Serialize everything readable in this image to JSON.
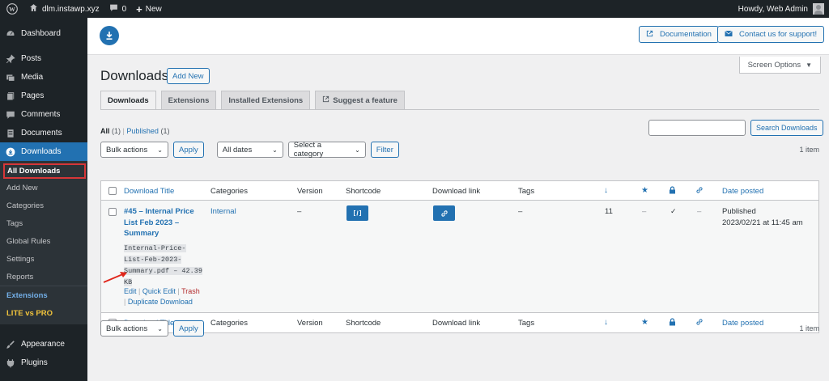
{
  "adminbar": {
    "site_name": "dlm.instawp.xyz",
    "comments_count": "0",
    "new_label": "New",
    "greeting": "Howdy, Web Admin"
  },
  "sidebar": {
    "items": [
      {
        "label": "Dashboard",
        "icon": "dashboard-icon"
      },
      {
        "label": "Posts",
        "icon": "pin-icon"
      },
      {
        "label": "Media",
        "icon": "media-icon"
      },
      {
        "label": "Pages",
        "icon": "pages-icon"
      },
      {
        "label": "Comments",
        "icon": "comment-icon"
      },
      {
        "label": "Documents",
        "icon": "document-icon"
      },
      {
        "label": "Downloads",
        "icon": "download-icon"
      }
    ],
    "submenu": [
      "All Downloads",
      "Add New",
      "Categories",
      "Tags",
      "Global Rules",
      "Settings",
      "Reports",
      "Extensions",
      "LITE vs PRO"
    ],
    "bottom_items": [
      {
        "label": "Appearance",
        "icon": "brush-icon"
      },
      {
        "label": "Plugins",
        "icon": "plugin-icon"
      }
    ]
  },
  "header": {
    "documentation_label": "Documentation",
    "support_label": "Contact us for support!",
    "screen_options_label": "Screen Options"
  },
  "page": {
    "title": "Downloads",
    "add_new_label": "Add New",
    "tabs": [
      "Downloads",
      "Extensions",
      "Installed Extensions",
      "Suggest a feature"
    ],
    "filters": {
      "all_label": "All",
      "all_count": "(1)",
      "sep": "|",
      "published_label": "Published",
      "published_count": "(1)"
    },
    "search_button_label": "Search Downloads",
    "bulk_actions_label": "Bulk actions",
    "apply_label": "Apply",
    "dates_label": "All dates",
    "category_label": "Select a category",
    "filter_label": "Filter",
    "items_count": "1 item"
  },
  "table": {
    "columns": {
      "title": "Download Title",
      "categories": "Categories",
      "version": "Version",
      "shortcode": "Shortcode",
      "download_link": "Download link",
      "tags": "Tags",
      "date": "Date posted"
    },
    "row": {
      "title_line1": "#45 – Internal Price",
      "title_line2": "List Feb 2023 –",
      "title_line3": "Summary",
      "file_line1": "Internal-Price-",
      "file_line2": "List-Feb-2023-",
      "file_line3": "Summary.pdf – 42.39",
      "file_line4": "KB",
      "edit_label": "Edit",
      "quick_edit_label": "Quick Edit",
      "trash_label": "Trash",
      "duplicate_label": "Duplicate Download",
      "action_sep": "|",
      "category": "Internal",
      "version": "–",
      "tags": "–",
      "downloads": "11",
      "featured": "–",
      "members_only": "✓",
      "redirect": "–",
      "status": "Published",
      "date": "2023/02/21 at 11:45 am"
    }
  },
  "colors": {
    "accent": "#2271b1",
    "sidebar_bg": "#1d2327",
    "highlight_border": "#d63638",
    "annotation_arrow": "#e0261b"
  }
}
